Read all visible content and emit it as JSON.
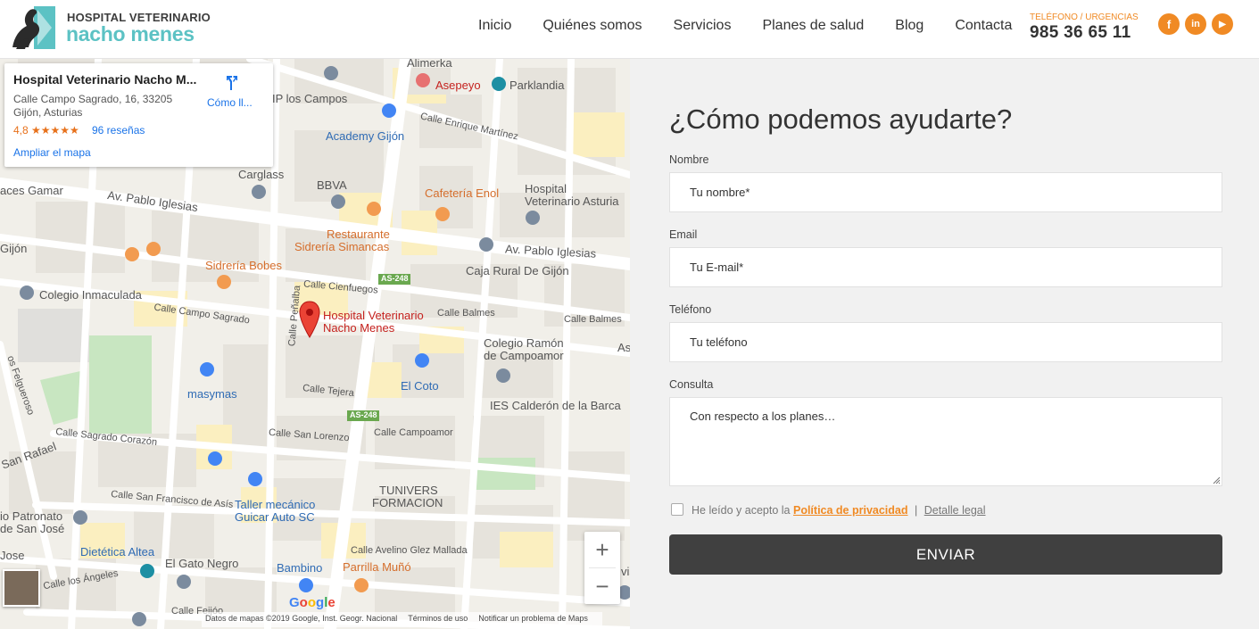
{
  "header": {
    "logo_line1": "HOSPITAL VETERINARIO",
    "logo_line2": "nacho menes",
    "nav": [
      "Inicio",
      "Quiénes somos",
      "Servicios",
      "Planes de salud",
      "Blog",
      "Contacta"
    ],
    "phone_label": "TELÉFONO / URGENCIAS",
    "phone_number": "985 36 65 11",
    "social": [
      {
        "icon": "facebook-icon",
        "glyph": "f"
      },
      {
        "icon": "linkedin-icon",
        "glyph": "in"
      },
      {
        "icon": "youtube-icon",
        "glyph": "▶"
      }
    ],
    "accent_color": "#f08a24",
    "brand_color": "#5cc2c4"
  },
  "map": {
    "card": {
      "title": "Hospital Veterinario Nacho M...",
      "address_line1": "Calle Campo Sagrado, 16, 33205",
      "address_line2": "Gijón, Asturias",
      "rating": "4,8 ★★★★★",
      "reviews": "96 reseñas",
      "enlarge": "Ampliar el mapa",
      "directions": "Cómo ll..."
    },
    "marker_label_line1": "Hospital Veterinario",
    "marker_label_line2": "Nacho Menes",
    "labels": {
      "alimerka": "Alimerka",
      "asepeyo": "Asepeyo",
      "parklandia": "Parklandia",
      "ip_los_campos": "IP los Campos",
      "calle_enrique_martinez": "Calle Enrique Martínez",
      "academy_gijon": "Academy Gijón",
      "carglass": "Carglass",
      "bbva": "BBVA",
      "cafeteria_enol": "Cafetería Enol",
      "hospital_vet_asturias_1": "Hospital",
      "hospital_vet_asturias_2": "Veterinario Asturia",
      "aces_gamar": "aces Gamar",
      "av_pablo_iglesias_1": "Av. Pablo Iglesias",
      "av_pablo_iglesias_2": "Av. Pablo Iglesias",
      "gijon": "Gijón",
      "restaurante_1": "Restaurante",
      "restaurante_2": "Sidrería Simancas",
      "sidreria_bobes": "Sidrería Bobes",
      "caja_rural": "Caja Rural De Gijón",
      "as248_1": "AS-248",
      "as248_2": "AS-248",
      "calle_cienfuegos": "Calle Cienfuegos",
      "colegio_inmaculada": "Colegio Inmaculada",
      "calle_penalba": "Calle Peñalba",
      "calle_balmes_1": "Calle Balmes",
      "calle_balmes_2": "Calle Balmes",
      "calle_campo_sagrado": "Calle Campo Sagrado",
      "colegio_ramon_1": "Colegio Ramón",
      "colegio_ramon_2": "de Campoamor",
      "as": "As",
      "masymas": "masymas",
      "el_coto": "El Coto",
      "calle_tejera": "Calle Tejera",
      "ies_calderon": "IES Calderón de la Barca",
      "felgueroso": "os Felgueroso",
      "calle_san_lorenzo": "Calle San Lorenzo",
      "calle_campoamor": "Calle Campoamor",
      "calle_sagrado_corazon": "Calle Sagrado Corazón",
      "san_rafael": "San Rafael",
      "tunivers_1": "TUNIVERS",
      "tunivers_2": "FORMACION",
      "calle_san_francisco": "Calle San Francisco de Asís",
      "taller_1": "Taller mecánico",
      "taller_2": "Guicar Auto SC",
      "patronato_1": "io Patronato",
      "patronato_2": "de San José",
      "calle_avelino": "Calle Avelino Glez Mallada",
      "dietetica": "Dietética Altea",
      "jose": "Jose",
      "el_gato_negro": "El Gato Negro",
      "bambino": "Bambino",
      "parrilla": "Parrilla Muñó",
      "calle_los_angeles": "Calle los Ángeles",
      "calle_feijoo": "Calle Feijóo",
      "vis": "vis"
    },
    "zoom_in": "+",
    "zoom_out": "−",
    "google": "Google",
    "attribution": [
      "Datos de mapas ©2019 Google, Inst. Geogr. Nacional",
      "Términos de uso",
      "Notificar un problema de Maps"
    ]
  },
  "form": {
    "title": "¿Cómo podemos ayudarte?",
    "name_label": "Nombre",
    "name_placeholder": "Tu nombre*",
    "email_label": "Email",
    "email_placeholder": "Tu E-mail*",
    "phone_label": "Teléfono",
    "phone_placeholder": "Tu teléfono",
    "query_label": "Consulta",
    "query_placeholder": "Con respecto a los planes…",
    "consent_prefix": "He leído y acepto la",
    "privacy_link": "Política de privacidad",
    "separator": "|",
    "legal_link": "Detalle legal",
    "submit": "ENVIAR"
  }
}
